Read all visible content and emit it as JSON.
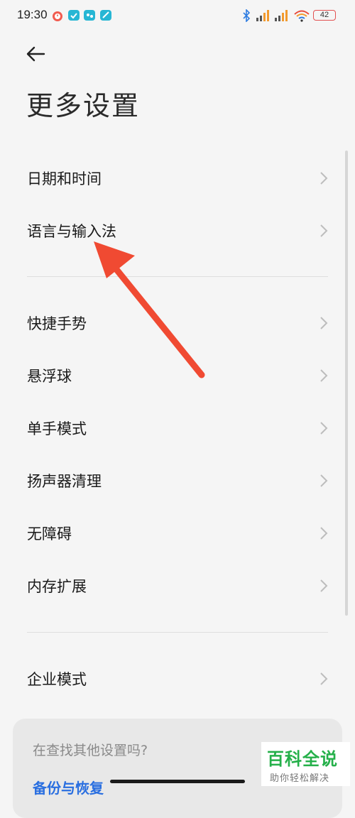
{
  "status_bar": {
    "time": "19:30",
    "battery": "42",
    "icons": [
      "alarm-icon",
      "app-notification-icon",
      "app-notification-icon",
      "app-notification-icon",
      "bluetooth-icon",
      "signal-icon",
      "signal-icon",
      "wifi-icon",
      "battery-icon"
    ]
  },
  "header": {
    "back_icon": "back-arrow-icon",
    "title": "更多设置"
  },
  "settings": {
    "group1": [
      {
        "label": "日期和时间"
      },
      {
        "label": "语言与输入法"
      }
    ],
    "group2": [
      {
        "label": "快捷手势"
      },
      {
        "label": "悬浮球"
      },
      {
        "label": "单手模式"
      },
      {
        "label": "扬声器清理"
      },
      {
        "label": "无障碍"
      },
      {
        "label": "内存扩展"
      }
    ],
    "group3": [
      {
        "label": "企业模式"
      }
    ]
  },
  "card": {
    "prompt": "在查找其他设置吗?",
    "link": "备份与恢复"
  },
  "watermark": {
    "title": "百科全说",
    "subtitle": "助你轻松解决"
  },
  "colors": {
    "background": "#f5f5f5",
    "accent_link": "#2a6fe0",
    "annotation_arrow": "#f04a32",
    "watermark_green": "#25b04a"
  }
}
